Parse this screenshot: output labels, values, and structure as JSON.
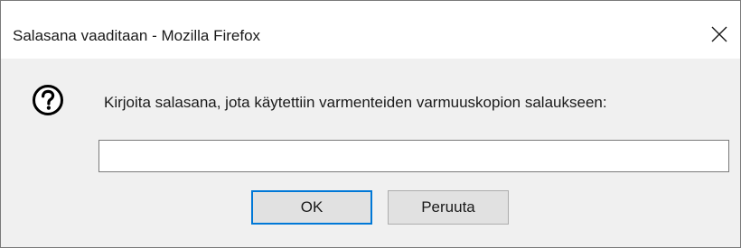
{
  "window": {
    "title": "Salasana vaaditaan - Mozilla Firefox",
    "close_glyph": "✕"
  },
  "dialog": {
    "icon": "question-icon",
    "prompt": "Kirjoita salasana, jota käytettiin varmenteiden varmuuskopion salaukseen:",
    "password_value": "",
    "ok_label": "OK",
    "cancel_label": "Peruuta"
  },
  "colors": {
    "accent": "#0078d7",
    "background": "#f0f0f0",
    "titlebar": "#ffffff"
  }
}
